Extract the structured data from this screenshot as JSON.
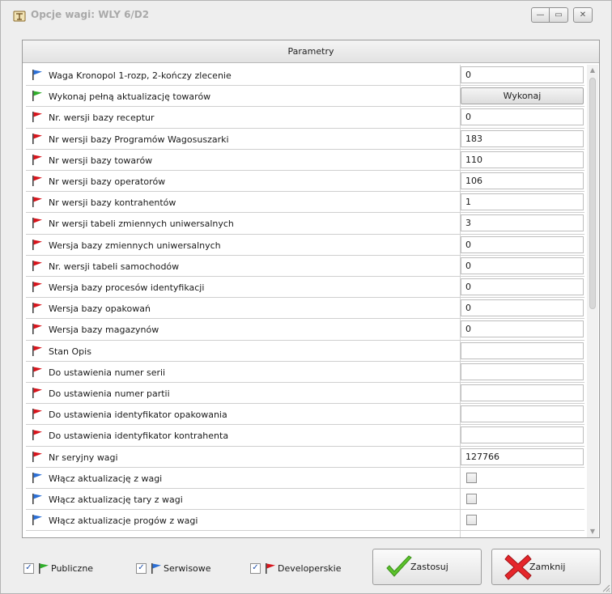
{
  "window": {
    "title": "Opcje wagi: WLY 6/D2",
    "icon": "scale-app-icon",
    "controls": [
      "minimize",
      "maximize",
      "close"
    ]
  },
  "panel": {
    "header": "Parametry"
  },
  "colors": {
    "flag_blue": "#2b6fd6",
    "flag_green": "#2fae2a",
    "flag_red": "#d8141c",
    "check_green": "#5cc22b",
    "close_red": "#e5262b"
  },
  "rows": [
    {
      "flag": "blue",
      "label": "Waga Kronopol 1-rozp, 2-kończy zlecenie",
      "type": "input",
      "value": "0"
    },
    {
      "flag": "green",
      "label": "Wykonaj pełną aktualizację towarów",
      "type": "button",
      "value": "Wykonaj"
    },
    {
      "flag": "red",
      "label": "Nr. wersji bazy receptur",
      "type": "input",
      "value": "0"
    },
    {
      "flag": "red",
      "label": "Nr wersji bazy Programów Wagosuszarki",
      "type": "input",
      "value": "183"
    },
    {
      "flag": "red",
      "label": "Nr wersji bazy towarów",
      "type": "input",
      "value": "110"
    },
    {
      "flag": "red",
      "label": "Nr wersji bazy operatorów",
      "type": "input",
      "value": "106"
    },
    {
      "flag": "red",
      "label": "Nr wersji bazy kontrahentów",
      "type": "input",
      "value": "1"
    },
    {
      "flag": "red",
      "label": "Nr wersji tabeli zmiennych uniwersalnych",
      "type": "input",
      "value": "3"
    },
    {
      "flag": "red",
      "label": "Wersja bazy zmiennych uniwersalnych",
      "type": "input",
      "value": "0"
    },
    {
      "flag": "red",
      "label": "Nr. wersji tabeli samochodów",
      "type": "input",
      "value": "0"
    },
    {
      "flag": "red",
      "label": "Wersja bazy procesów identyfikacji",
      "type": "input",
      "value": "0"
    },
    {
      "flag": "red",
      "label": "Wersja bazy opakowań",
      "type": "input",
      "value": "0"
    },
    {
      "flag": "red",
      "label": "Wersja bazy magazynów",
      "type": "input",
      "value": "0"
    },
    {
      "flag": "red",
      "label": "Stan Opis",
      "type": "input",
      "value": ""
    },
    {
      "flag": "red",
      "label": "Do ustawienia numer serii",
      "type": "input",
      "value": ""
    },
    {
      "flag": "red",
      "label": "Do ustawienia numer partii",
      "type": "input",
      "value": ""
    },
    {
      "flag": "red",
      "label": "Do ustawienia identyfikator opakowania",
      "type": "input",
      "value": ""
    },
    {
      "flag": "red",
      "label": "Do ustawienia identyfikator kontrahenta",
      "type": "input",
      "value": ""
    },
    {
      "flag": "red",
      "label": "Nr seryjny wagi",
      "type": "input",
      "value": "127766"
    },
    {
      "flag": "blue",
      "label": "Włącz aktualizację z wagi",
      "type": "checkbox",
      "checked": false
    },
    {
      "flag": "blue",
      "label": "Włącz aktualizację tary z wagi",
      "type": "checkbox",
      "checked": false
    },
    {
      "flag": "blue",
      "label": "Włącz aktualizacje progów z wagi",
      "type": "checkbox",
      "checked": false
    }
  ],
  "filters": [
    {
      "label": "Publiczne",
      "flag": "green",
      "checked": true
    },
    {
      "label": "Serwisowe",
      "flag": "blue",
      "checked": true
    },
    {
      "label": "Developerskie",
      "flag": "red",
      "checked": true
    }
  ],
  "buttons": {
    "apply": {
      "label": "Zastosuj",
      "icon": "checkmark-icon"
    },
    "close": {
      "label": "Zamknij",
      "icon": "red-x-icon"
    }
  }
}
